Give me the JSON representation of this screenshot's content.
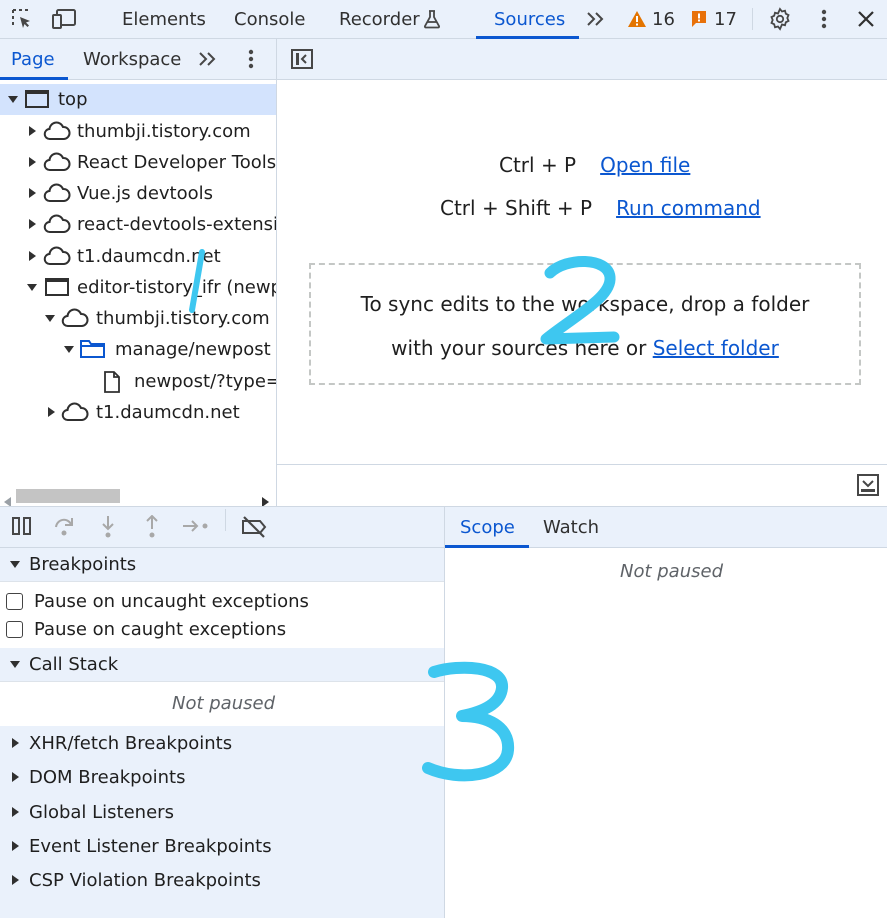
{
  "toolbar": {
    "tabs": [
      {
        "label": "Elements"
      },
      {
        "label": "Console"
      },
      {
        "label": "Recorder"
      },
      {
        "label": "Sources",
        "active": true
      }
    ],
    "warnings_count": "16",
    "issues_count": "17",
    "icons": [
      "inspect-element-icon",
      "device-toolbar-icon",
      "flask-icon",
      "more-tabs-icon",
      "warning-icon",
      "issue-icon",
      "gear-icon",
      "kebab-menu-icon",
      "close-icon"
    ]
  },
  "navigator": {
    "tabs": [
      {
        "label": "Page",
        "active": true
      },
      {
        "label": "Workspace"
      }
    ]
  },
  "tree": [
    {
      "label": "top",
      "expanded": true,
      "icon": "frame-icon",
      "selected": true
    },
    {
      "label": "thumbji.tistory.com",
      "expanded": false,
      "icon": "cloud-icon"
    },
    {
      "label": "React Developer Tools",
      "expanded": false,
      "icon": "cloud-icon"
    },
    {
      "label": "Vue.js devtools",
      "expanded": false,
      "icon": "cloud-icon"
    },
    {
      "label": "react-devtools-extension",
      "expanded": false,
      "icon": "cloud-icon"
    },
    {
      "label": "t1.daumcdn.net",
      "expanded": false,
      "icon": "cloud-icon"
    },
    {
      "label": "editor-tistory_ifr (newpost)",
      "expanded": true,
      "icon": "frame-icon"
    },
    {
      "label": "thumbji.tistory.com",
      "expanded": true,
      "icon": "cloud-icon"
    },
    {
      "label": "manage/newpost",
      "expanded": true,
      "icon": "folder-icon"
    },
    {
      "label": "newpost/?type=post",
      "icon": "file-icon"
    },
    {
      "label": "t1.daumcdn.net",
      "expanded": false,
      "icon": "cloud-icon"
    }
  ],
  "editor": {
    "shortcuts": [
      {
        "keys": "Ctrl + P",
        "action": "Open file"
      },
      {
        "keys": "Ctrl + Shift + P",
        "action": "Run command"
      }
    ],
    "dropzone_line1": "To sync edits to the workspace, drop a folder",
    "dropzone_line2_prefix": "with your sources here or ",
    "dropzone_link": "Select folder"
  },
  "scope": {
    "tabs": [
      {
        "label": "Scope",
        "active": true
      },
      {
        "label": "Watch"
      }
    ],
    "status": "Not paused"
  },
  "panes": {
    "breakpoints": {
      "title": "Breakpoints",
      "options": [
        "Pause on uncaught exceptions",
        "Pause on caught exceptions"
      ]
    },
    "call_stack": {
      "title": "Call Stack",
      "status": "Not paused"
    },
    "collapsed": [
      "XHR/fetch Breakpoints",
      "DOM Breakpoints",
      "Global Listeners",
      "Event Listener Breakpoints",
      "CSP Violation Breakpoints"
    ]
  },
  "annotations": {
    "one": "1",
    "two": "2",
    "three": "3"
  },
  "colors": {
    "accent": "#0b57d0",
    "toolbar_bg": "#eaf1fb",
    "warning": "#e37400",
    "issue": "#e8710a",
    "annotation": "#3ec7f0"
  }
}
